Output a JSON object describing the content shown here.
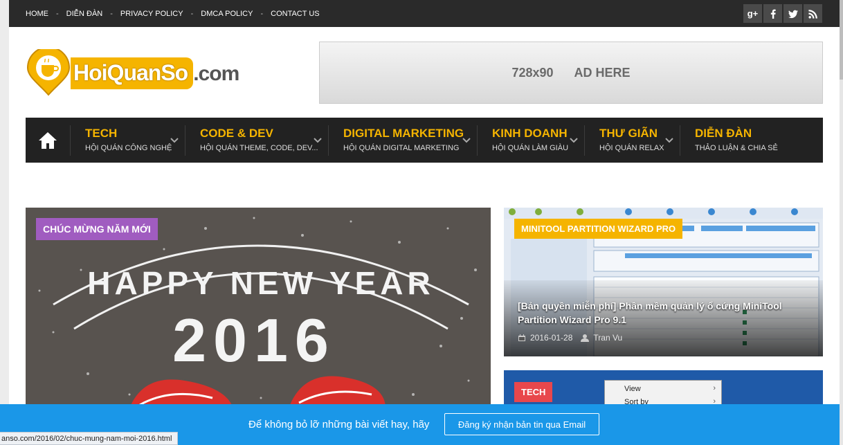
{
  "topnav": {
    "items": [
      {
        "label": "HOME"
      },
      {
        "label": "DIỄN ĐÀN"
      },
      {
        "label": "PRIVACY POLICY"
      },
      {
        "label": "DMCA POLICY"
      },
      {
        "label": "CONTACT US"
      }
    ],
    "separator": "-"
  },
  "social": {
    "google_label": "g+",
    "icons": [
      "google-plus-icon",
      "facebook-icon",
      "twitter-icon",
      "rss-icon"
    ]
  },
  "logo": {
    "main": "HoiQuanSo",
    "suffix": ".com"
  },
  "ad": {
    "size": "728x90",
    "text": "AD HERE"
  },
  "mainnav": {
    "items": [
      {
        "title": "TECH",
        "subtitle": "HỘI QUÁN CÔNG NGHỆ",
        "has_dropdown": true
      },
      {
        "title": "CODE & DEV",
        "subtitle": "HỘI QUÁN THEME, CODE, DEV...",
        "has_dropdown": true
      },
      {
        "title": "DIGITAL MARKETING",
        "subtitle": "HỘI QUÁN DIGITAL MARKETING",
        "has_dropdown": true
      },
      {
        "title": "KINH DOANH",
        "subtitle": "HỘI QUÁN LÀM GIÀU",
        "has_dropdown": true
      },
      {
        "title": "THƯ GIÃN",
        "subtitle": "HỘI QUÁN RELAX",
        "has_dropdown": true
      },
      {
        "title": "DIỄN ĐÀN",
        "subtitle": "THẢO LUẬN & CHIA SẺ",
        "has_dropdown": false
      }
    ]
  },
  "features": {
    "left": {
      "category": "CHÚC MỪNG NĂM MỚI",
      "category_color": "#a05cc0",
      "image_text": "HAPPY NEW YEAR",
      "image_year": "2016"
    },
    "right1": {
      "category": "MINITOOL PARTITION WIZARD PRO",
      "category_color": "#f5b400",
      "title": "[Bản quyền miễn phí] Phần mềm quản lý ổ cứng MiniTool Partition Wizard Pro 9.1",
      "date": "2016-01-28",
      "author": "Tran Vu"
    },
    "right2": {
      "category": "TECH",
      "category_color": "#e8474c",
      "menu": [
        "View",
        "Sort by"
      ]
    }
  },
  "subscribe": {
    "text": "Để không bỏ lỡ những bài viết hay, hãy",
    "button": "Đăng ký nhận bản tin qua Email"
  },
  "statusbar": {
    "url": "anso.com/2016/02/chuc-mung-nam-moi-2016.html"
  },
  "colors": {
    "accent": "#f5b400",
    "topbar": "#2a2a2a",
    "nav": "#222222",
    "subscribe": "#1a97e8"
  }
}
